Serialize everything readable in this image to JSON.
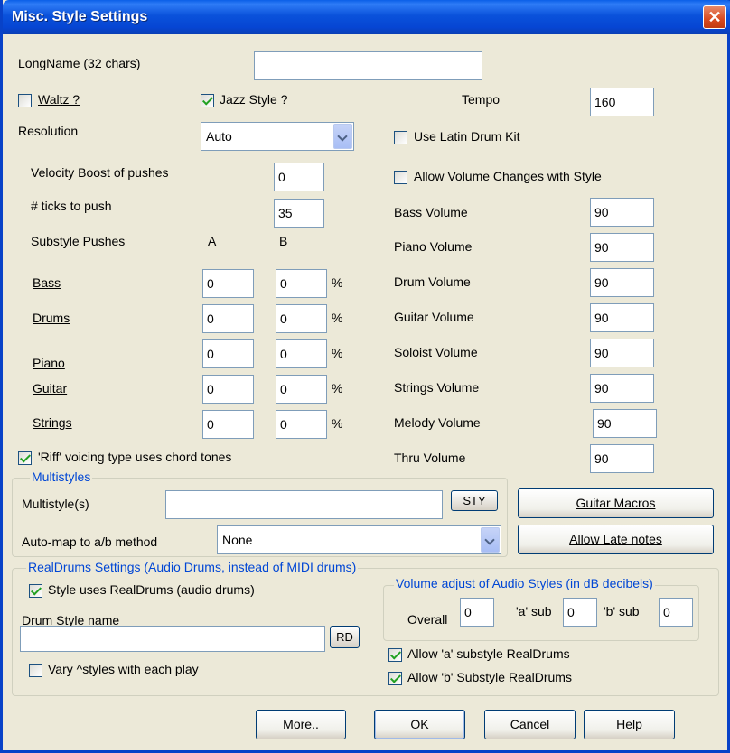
{
  "window": {
    "title": "Misc. Style Settings",
    "close_icon": "close-icon"
  },
  "longname": {
    "label": "LongName (32 chars)",
    "value": ""
  },
  "waltz": {
    "label": "Waltz ?",
    "checked": false
  },
  "jazz": {
    "label": "Jazz Style ?",
    "checked": true
  },
  "tempo": {
    "label": "Tempo",
    "value": "160"
  },
  "resolution": {
    "label": "Resolution",
    "value": "Auto"
  },
  "latin": {
    "label": "Use Latin Drum Kit",
    "checked": false
  },
  "velocity": {
    "label": "Velocity Boost of pushes",
    "value": "0"
  },
  "ticks": {
    "label": "# ticks to push",
    "value": "35"
  },
  "allow_volume": {
    "label": "Allow Volume Changes with Style",
    "checked": false
  },
  "pushes": {
    "header": "Substyle Pushes",
    "col_a": "A",
    "col_b": "B",
    "percent": "%",
    "rows": [
      {
        "label": "Bass",
        "a": "0",
        "b": "0"
      },
      {
        "label": "Drums",
        "a": "0",
        "b": "0"
      },
      {
        "label": "Piano",
        "a": "0",
        "b": "0"
      },
      {
        "label": "Guitar",
        "a": "0",
        "b": "0"
      },
      {
        "label": "Strings",
        "a": "0",
        "b": "0"
      }
    ]
  },
  "volumes": [
    {
      "label": "Bass Volume",
      "value": "90"
    },
    {
      "label": "Piano Volume",
      "value": "90"
    },
    {
      "label": "Drum Volume",
      "value": "90"
    },
    {
      "label": "Guitar Volume",
      "value": "90"
    },
    {
      "label": "Soloist Volume",
      "value": "90"
    },
    {
      "label": "Strings Volume",
      "value": "90"
    },
    {
      "label": "Melody Volume",
      "value": "90"
    },
    {
      "label": "Thru Volume",
      "value": "90"
    }
  ],
  "riff": {
    "label": "'Riff' voicing type uses chord tones",
    "checked": true
  },
  "multistyles": {
    "group_title": "Multistyles",
    "label": "Multistyle(s)",
    "value": "",
    "sty_button": "STY",
    "automap_label": "Auto-map to a/b method",
    "automap_value": "None"
  },
  "buttons": {
    "guitar_macros": "Guitar Macros",
    "allow_late": "Allow Late notes",
    "more": "More..",
    "ok": "OK",
    "cancel": "Cancel",
    "help": "Help"
  },
  "realdrums": {
    "group_title": "RealDrums Settings (Audio Drums, instead of MIDI drums)",
    "uses_label": "Style uses RealDrums (audio drums)",
    "uses_checked": true,
    "name_label": "Drum Style name",
    "name_value": "",
    "rd_button": "RD",
    "vary_label": "Vary ^styles with each play",
    "vary_checked": false,
    "allow_a_label": "Allow 'a' substyle RealDrums",
    "allow_a_checked": true,
    "allow_b_label": "Allow 'b' Substyle RealDrums",
    "allow_b_checked": true
  },
  "volume_adjust": {
    "group_title": "Volume adjust of Audio Styles (in dB decibels)",
    "overall_label": "Overall",
    "overall_value": "0",
    "a_label": "'a' sub",
    "a_value": "0",
    "b_label": "'b' sub",
    "b_value": "0"
  }
}
